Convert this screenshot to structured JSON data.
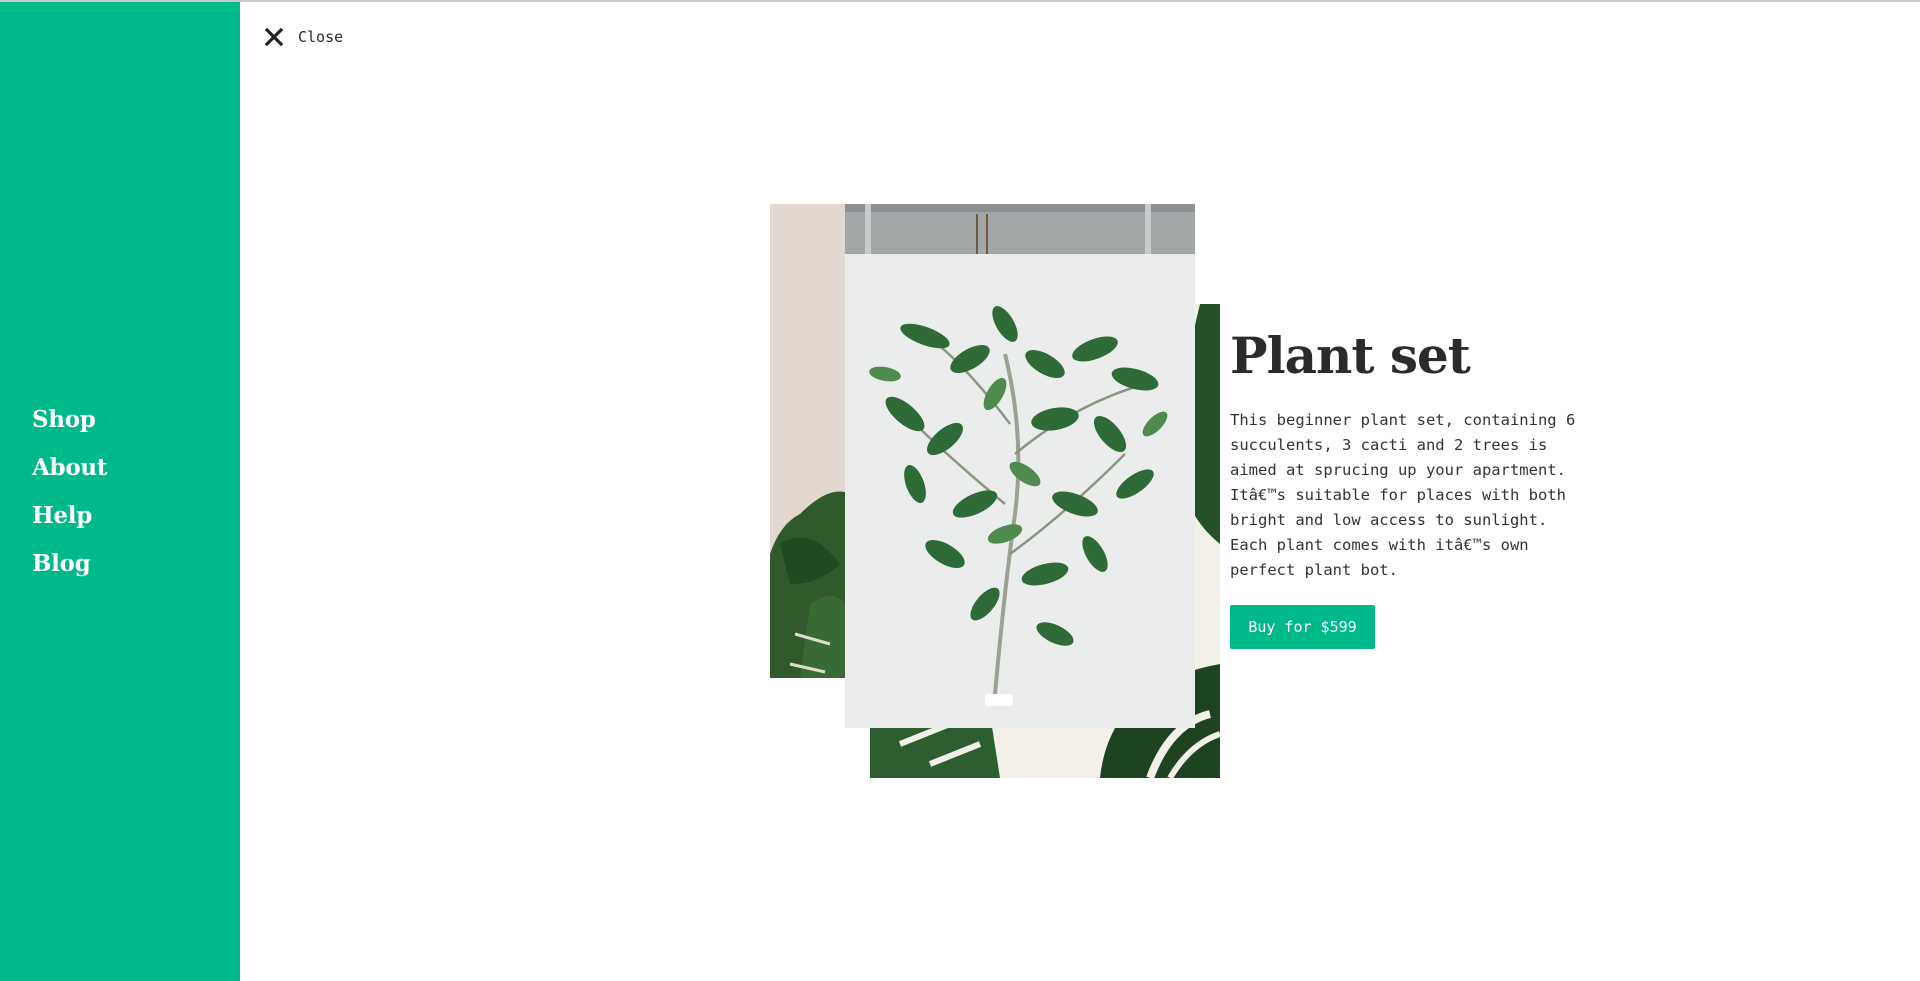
{
  "sidebar": {
    "color": "#00b98a",
    "items": [
      {
        "label": "Shop"
      },
      {
        "label": "About"
      },
      {
        "label": "Help"
      },
      {
        "label": "Blog"
      }
    ]
  },
  "close": {
    "label": "Close",
    "icon": "close-icon"
  },
  "product": {
    "title": "Plant set",
    "description": "This beginner plant set, containing 6 succulents, 3 cacti and 2 trees is aimed at sprucing up your apartment. Itâ€™s suitable for places with both bright and low access to sunlight. Each plant comes with itâ€™s own perfect plant bot.",
    "buy_label": "Buy for $599",
    "accent": "#00b98a"
  }
}
